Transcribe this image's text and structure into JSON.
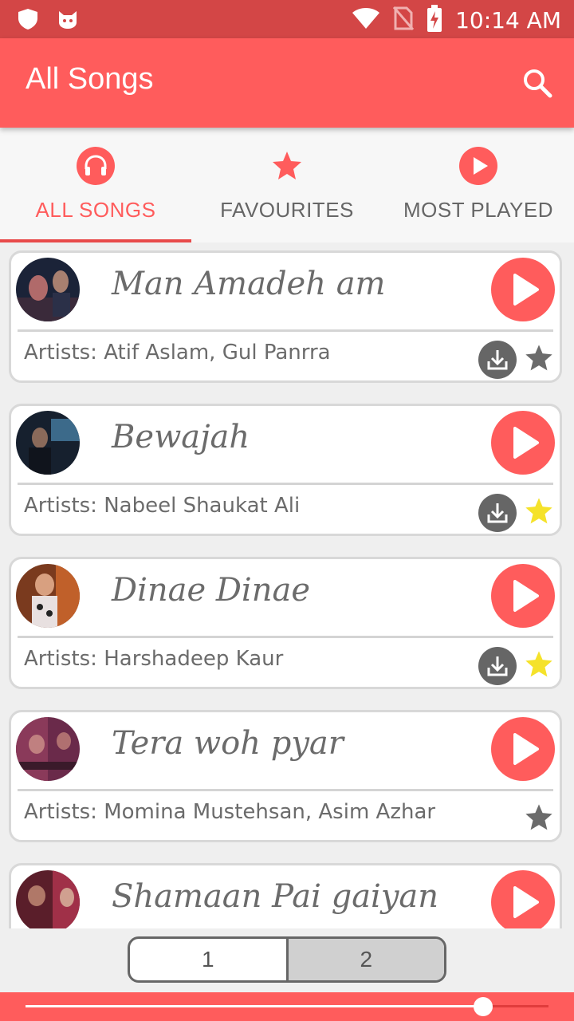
{
  "status_bar": {
    "time": "10:14 AM",
    "left_icons": [
      "shield-icon",
      "cat-icon"
    ],
    "right_icons": [
      "wifi-icon",
      "no-sim-icon",
      "battery-charging-icon"
    ]
  },
  "app_bar": {
    "title": "All Songs",
    "search_icon": "search-icon"
  },
  "tabs": [
    {
      "label": "ALL SONGS",
      "icon": "headphones-icon",
      "active": true
    },
    {
      "label": "FAVOURITES",
      "icon": "star-icon",
      "active": false
    },
    {
      "label": "MOST PLAYED",
      "icon": "play-circle-icon",
      "active": false
    }
  ],
  "songs": [
    {
      "title": "Man Amadeh am",
      "artists": "Artists: Atif Aslam, Gul Panrra",
      "downloadable": true,
      "favourite": false
    },
    {
      "title": "Bewajah",
      "artists": "Artists: Nabeel Shaukat Ali",
      "downloadable": true,
      "favourite": true
    },
    {
      "title": "Dinae Dinae",
      "artists": "Artists: Harshadeep Kaur",
      "downloadable": true,
      "favourite": true
    },
    {
      "title": "Tera woh pyar",
      "artists": "Artists: Momina Mustehsan, Asim Azhar",
      "downloadable": false,
      "favourite": false
    },
    {
      "title": "Shamaan Pai gaiyan",
      "artists": "",
      "downloadable": false,
      "favourite": false
    }
  ],
  "pagination": {
    "pages": [
      "1",
      "2"
    ],
    "selected": "1"
  },
  "player": {
    "progress": 0.875
  },
  "colors": {
    "accent": "#ff5c5c",
    "status_bar": "#d34646",
    "favourite_star": "#f5e22a",
    "star_inactive": "#6b6b6b"
  }
}
